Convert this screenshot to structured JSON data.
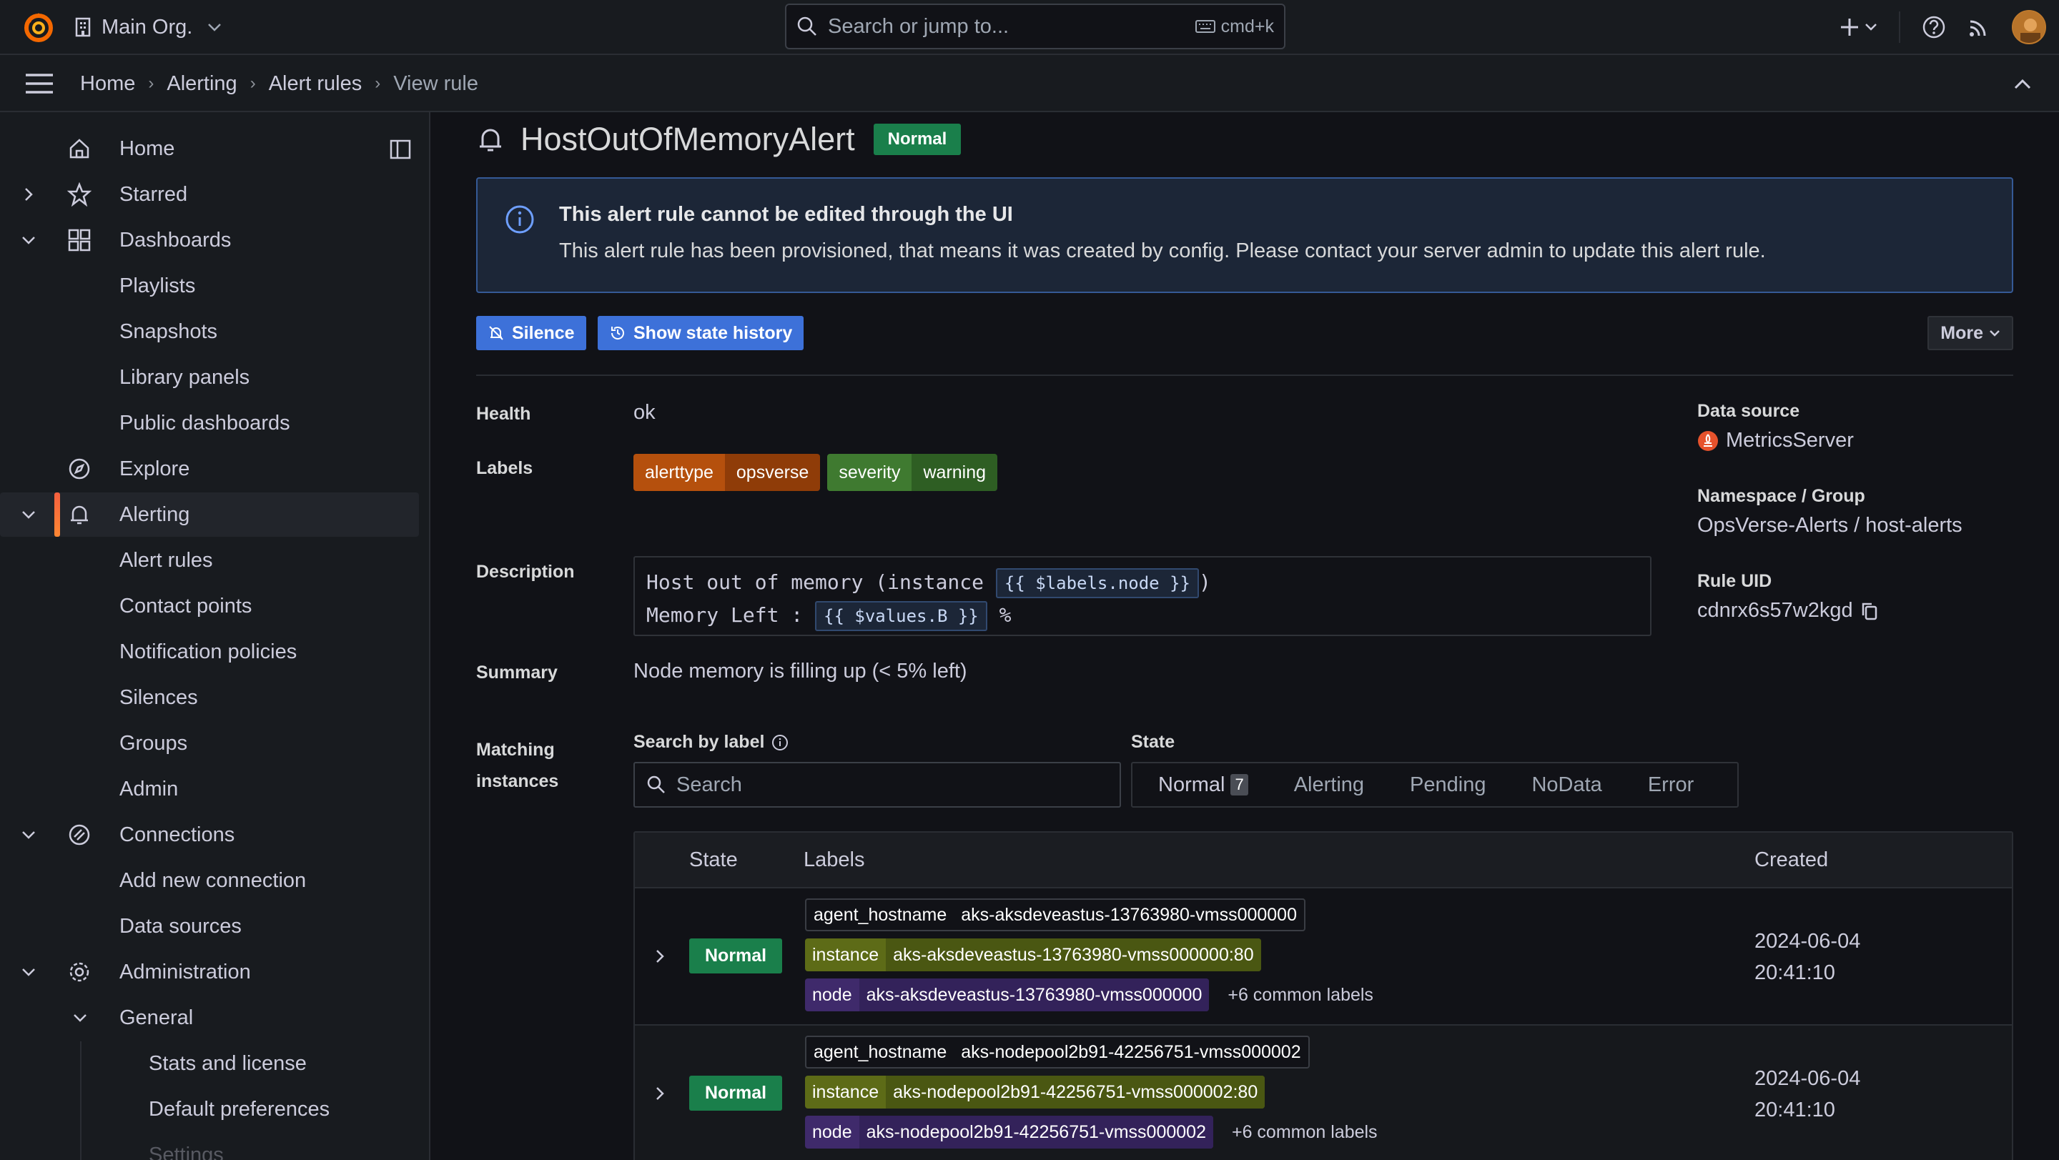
{
  "topbar": {
    "org": "Main Org.",
    "search_placeholder": "Search or jump to...",
    "shortcut": "cmd+k"
  },
  "breadcrumb": [
    "Home",
    "Alerting",
    "Alert rules",
    "View rule"
  ],
  "sidebar": {
    "items": [
      {
        "label": "Home"
      },
      {
        "label": "Starred"
      },
      {
        "label": "Dashboards"
      },
      {
        "label": "Playlists"
      },
      {
        "label": "Snapshots"
      },
      {
        "label": "Library panels"
      },
      {
        "label": "Public dashboards"
      },
      {
        "label": "Explore"
      },
      {
        "label": "Alerting"
      },
      {
        "label": "Alert rules"
      },
      {
        "label": "Contact points"
      },
      {
        "label": "Notification policies"
      },
      {
        "label": "Silences"
      },
      {
        "label": "Groups"
      },
      {
        "label": "Admin"
      },
      {
        "label": "Connections"
      },
      {
        "label": "Add new connection"
      },
      {
        "label": "Data sources"
      },
      {
        "label": "Administration"
      },
      {
        "label": "General"
      },
      {
        "label": "Stats and license"
      },
      {
        "label": "Default preferences"
      },
      {
        "label": "Settings"
      }
    ]
  },
  "rule": {
    "title": "HostOutOfMemoryAlert",
    "state": "Normal",
    "info_title": "This alert rule cannot be edited through the UI",
    "info_body": "This alert rule has been provisioned, that means it was created by config. Please contact your server admin to update this alert rule.",
    "silence_label": "Silence",
    "history_label": "Show state history",
    "more_label": "More",
    "health_key": "Health",
    "health_value": "ok",
    "labels_key": "Labels",
    "labels": [
      {
        "key": "alerttype",
        "value": "opsverse",
        "key_color": "#b5500d",
        "value_color": "#8f3c08"
      },
      {
        "key": "severity",
        "value": "warning",
        "key_color": "#3f7a30",
        "value_color": "#2e5e23"
      }
    ],
    "description_key": "Description",
    "description_line1_prefix": "Host out of memory (instance ",
    "description_line1_tmpl": "{{ $labels.node }}",
    "description_line1_suffix": ")",
    "description_line2_prefix": "Memory Left : ",
    "description_line2_tmpl": "{{ $values.B }}",
    "description_line2_suffix": " %",
    "summary_key": "Summary",
    "summary_value": "Node memory is filling up (< 5% left)",
    "datasource_key": "Data source",
    "datasource_value": "MetricsServer",
    "namespace_key": "Namespace / Group",
    "namespace_value": "OpsVerse-Alerts / host-alerts",
    "uid_key": "Rule UID",
    "uid_value": "cdnrx6s57w2kgd"
  },
  "instances": {
    "section_label_1": "Matching",
    "section_label_2": "instances",
    "search_label": "Search by label",
    "search_placeholder": "Search",
    "state_label": "State",
    "state_filters": [
      "Normal",
      "Alerting",
      "Pending",
      "NoData",
      "Error"
    ],
    "normal_count": "7",
    "columns": {
      "state": "State",
      "labels": "Labels",
      "created": "Created"
    },
    "rows": [
      {
        "state": "Normal",
        "agent_hostname_key": "agent_hostname",
        "agent_hostname": "aks-aksdeveastus-13763980-vmss000000",
        "instance_key": "instance",
        "instance": "aks-aksdeveastus-13763980-vmss000000:80",
        "node_key": "node",
        "node": "aks-aksdeveastus-13763980-vmss000000",
        "common": "+6 common labels",
        "created_date": "2024-06-04",
        "created_time": "20:41:10"
      },
      {
        "state": "Normal",
        "agent_hostname_key": "agent_hostname",
        "agent_hostname": "aks-nodepool2b91-42256751-vmss000002",
        "instance_key": "instance",
        "instance": "aks-nodepool2b91-42256751-vmss000002:80",
        "node_key": "node",
        "node": "aks-nodepool2b91-42256751-vmss000002",
        "common": "+6 common labels",
        "created_date": "2024-06-04",
        "created_time": "20:41:10"
      }
    ]
  },
  "colors": {
    "accent": "#f55f3e",
    "primary_button": "#3d71d9",
    "success": "#1a7f4b",
    "info_border": "#355a96",
    "label_agent": "#111217",
    "label_instance": "#5d6b17",
    "label_node": "#3f2a6b"
  }
}
